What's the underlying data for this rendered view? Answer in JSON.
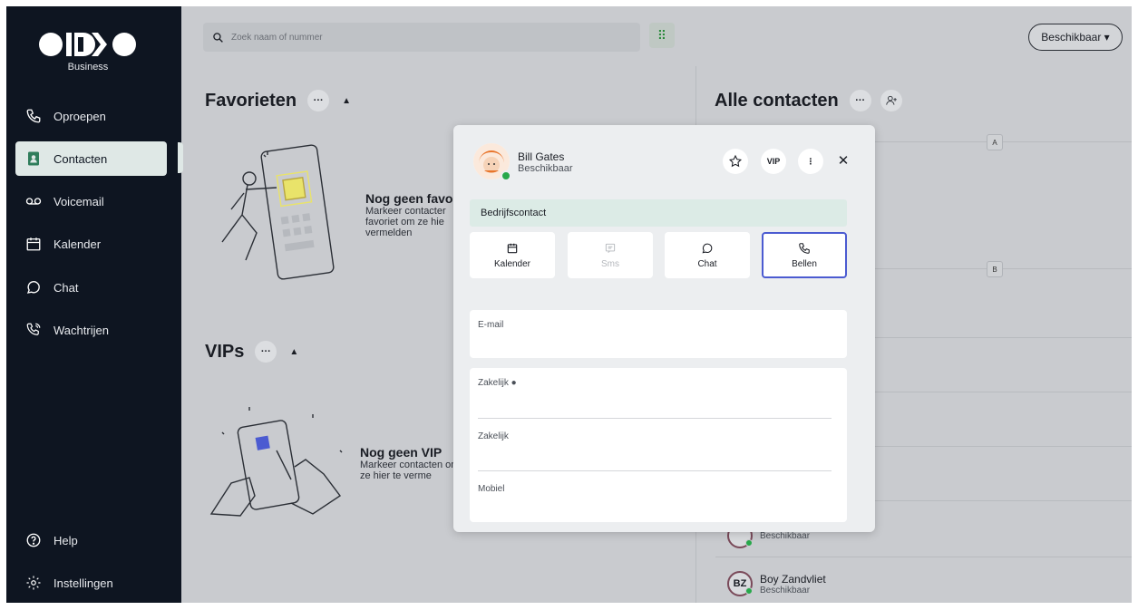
{
  "app": {
    "logo_sub": "Business"
  },
  "sidebar": {
    "items": [
      {
        "label": "Oproepen",
        "icon": "phone-icon"
      },
      {
        "label": "Contacten",
        "icon": "contacts-icon"
      },
      {
        "label": "Voicemail",
        "icon": "voicemail-icon"
      },
      {
        "label": "Kalender",
        "icon": "calendar-icon"
      },
      {
        "label": "Chat",
        "icon": "chat-icon"
      },
      {
        "label": "Wachtrijen",
        "icon": "queue-icon"
      }
    ],
    "bottom": [
      {
        "label": "Help",
        "icon": "help-icon"
      },
      {
        "label": "Instellingen",
        "icon": "gear-icon"
      }
    ]
  },
  "topbar": {
    "search_placeholder": "Zoek naam of nummer",
    "status_label": "Beschikbaar ▾"
  },
  "favorites": {
    "title": "Favorieten",
    "empty_title": "Nog geen favo",
    "empty_text": "Markeer contacter favoriet om ze hie vermelden"
  },
  "vips": {
    "title": "VIPs",
    "empty_title": "Nog geen VIP",
    "empty_text": "Markeer contacten om ze hier te verme"
  },
  "contacts": {
    "title": "Alle contacten",
    "letters": [
      "A",
      "B"
    ],
    "rows": [
      {
        "initials": "",
        "name": "",
        "status": "Beschikbaar"
      },
      {
        "initials": "BZ",
        "name": "Boy Zandvliet",
        "status": "Beschikbaar"
      }
    ]
  },
  "modal": {
    "name": "Bill Gates",
    "status": "Beschikbaar",
    "vip_label": "VIP",
    "banner": "Bedrijfscontact",
    "actions": [
      {
        "label": "Kalender",
        "icon": "calendar-icon",
        "enabled": true
      },
      {
        "label": "Sms",
        "icon": "sms-icon",
        "enabled": false
      },
      {
        "label": "Chat",
        "icon": "chat-icon",
        "enabled": true
      },
      {
        "label": "Bellen",
        "icon": "phone-icon",
        "enabled": true
      }
    ],
    "fields": {
      "email_label": "E-mail",
      "business1_label": "Zakelijk ●",
      "business2_label": "Zakelijk",
      "mobile_label": "Mobiel"
    }
  }
}
